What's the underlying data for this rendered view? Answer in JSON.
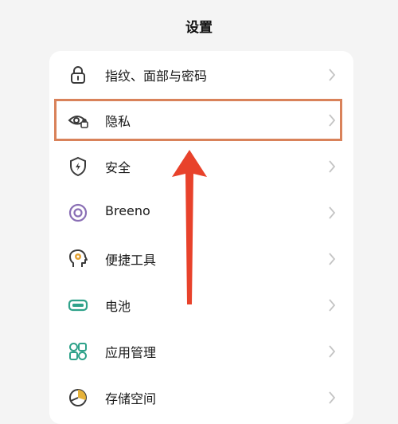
{
  "header": {
    "title": "设置"
  },
  "settings": {
    "items": [
      {
        "label": "指纹、面部与密码",
        "icon": "lock-icon"
      },
      {
        "label": "隐私",
        "icon": "privacy-eye-icon"
      },
      {
        "label": "安全",
        "icon": "shield-icon"
      },
      {
        "label": "Breeno",
        "icon": "breeno-icon"
      },
      {
        "label": "便捷工具",
        "icon": "tools-head-icon"
      },
      {
        "label": "电池",
        "icon": "battery-icon"
      },
      {
        "label": "应用管理",
        "icon": "apps-icon"
      },
      {
        "label": "存储空间",
        "icon": "storage-pie-icon"
      }
    ]
  },
  "colors": {
    "icon_gray": "#3a3a3a",
    "icon_green": "#2fa28a",
    "breeno_purple": "#8a6fb5",
    "tools_yellow": "#e3a234",
    "storage_yellow": "#e6b23a",
    "highlight_border": "#d9825a",
    "arrow_red": "#e8422b",
    "chevron": "#c4c4c4"
  }
}
